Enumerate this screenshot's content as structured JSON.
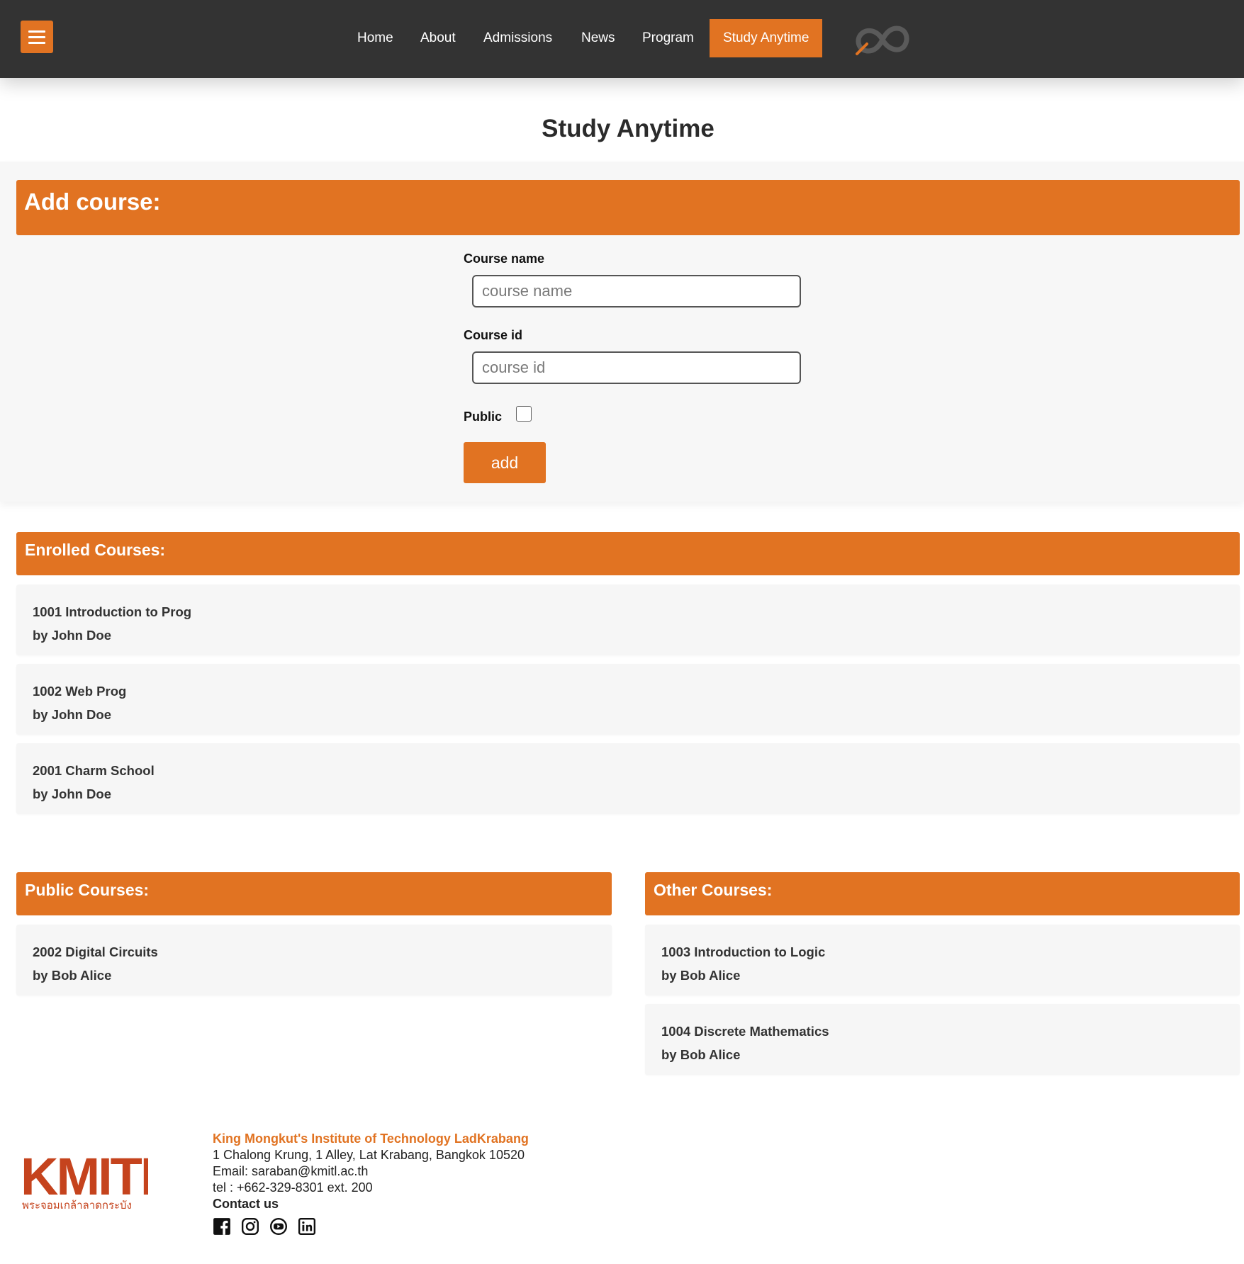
{
  "nav": {
    "items": [
      {
        "label": "Home"
      },
      {
        "label": "About"
      },
      {
        "label": "Admissions"
      },
      {
        "label": "News"
      },
      {
        "label": "Program"
      },
      {
        "label": "Study Anytime",
        "active": true
      }
    ],
    "menu_icon": "hamburger-menu-icon",
    "logo_icon": "infinity-logo-icon"
  },
  "page": {
    "title": "Study Anytime"
  },
  "add_course": {
    "header": "Add course:",
    "course_name_label": "Course name",
    "course_name_placeholder": "course name",
    "course_name_value": "",
    "course_id_label": "Course id",
    "course_id_placeholder": "course id",
    "course_id_value": "",
    "public_label": "Public",
    "public_checked": false,
    "add_label": "add"
  },
  "enrolled": {
    "header": "Enrolled Courses:",
    "courses": [
      {
        "title": "1001 Introduction to Prog",
        "author": "by John Doe"
      },
      {
        "title": "1002 Web Prog",
        "author": "by John Doe"
      },
      {
        "title": "2001 Charm School",
        "author": "by John Doe"
      }
    ]
  },
  "public_courses": {
    "header": "Public Courses:",
    "courses": [
      {
        "title": "2002 Digital Circuits",
        "author": "by Bob Alice"
      }
    ]
  },
  "other_courses": {
    "header": "Other Courses:",
    "courses": [
      {
        "title": "1003 Introduction to Logic",
        "author": "by Bob Alice"
      },
      {
        "title": "1004 Discrete Mathematics",
        "author": "by Bob Alice"
      }
    ]
  },
  "footer": {
    "logo_text": "KMITL",
    "logo_subtext": "พระจอมเกล้าลาดกระบัง",
    "institute": "King Mongkut's Institute of Technology LadKrabang",
    "address": "1 Chalong Krung, 1 Alley, Lat Krabang, Bangkok 10520",
    "email": "Email: saraban@kmitl.ac.th",
    "tel": "tel : +662-329-8301 ext. 200",
    "contact": "Contact us",
    "socials": [
      "facebook-icon",
      "instagram-icon",
      "youtube-icon",
      "linkedin-icon"
    ]
  },
  "colors": {
    "accent": "#e17322",
    "navbar": "#333333",
    "card": "#f6f6f6"
  }
}
